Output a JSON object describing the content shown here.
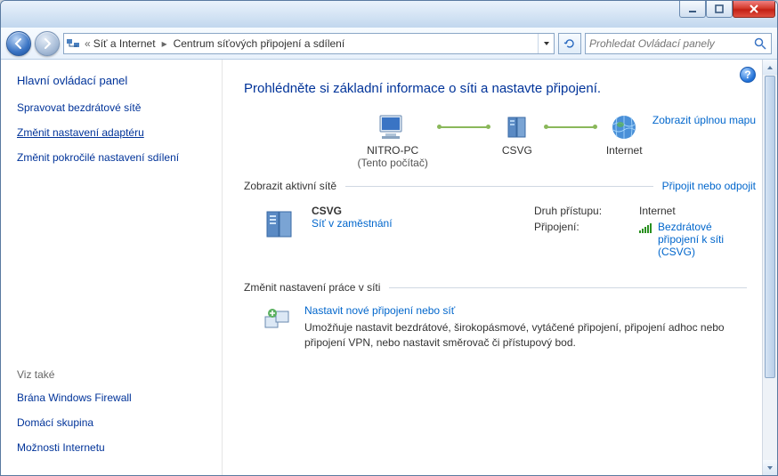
{
  "titlebar": {
    "minimize": "Minimize",
    "maximize": "Maximize",
    "close": "Close"
  },
  "breadcrumb": {
    "root_tip": "Ovládací panely",
    "seg1": "Síť a Internet",
    "seg2": "Centrum síťových připojení a sdílení"
  },
  "search": {
    "placeholder": "Prohledat Ovládací panely"
  },
  "sidebar": {
    "heading": "Hlavní ovládací panel",
    "items": [
      "Spravovat bezdrátové sítě",
      "Změnit nastavení adaptéru",
      "Změnit pokročilé nastavení sdílení"
    ],
    "see_also": "Viz také",
    "see_items": [
      "Brána Windows Firewall",
      "Domácí skupina",
      "Možnosti Internetu"
    ]
  },
  "main": {
    "heading": "Prohlédněte si základní informace o síti a nastavte připojení.",
    "full_map": "Zobrazit úplnou mapu",
    "nodes": {
      "pc": "NITRO-PC",
      "pc_sub": "(Tento počítač)",
      "gw": "CSVG",
      "net": "Internet"
    },
    "active_title": "Zobrazit aktivní sítě",
    "active_action": "Připojit nebo odpojit",
    "network": {
      "name": "CSVG",
      "type": "Síť v zaměstnání",
      "access_lbl": "Druh přístupu:",
      "access_val": "Internet",
      "conn_lbl": "Připojení:",
      "conn_val": "Bezdrátové připojení k síti (CSVG)"
    },
    "change_title": "Změnit nastavení práce v síti",
    "task1": {
      "title": "Nastavit nové připojení nebo síť",
      "desc": "Umožňuje nastavit bezdrátové, širokopásmové, vytáčené připojení, připojení adhoc nebo připojení VPN, nebo nastavit směrovač či přístupový bod."
    }
  }
}
